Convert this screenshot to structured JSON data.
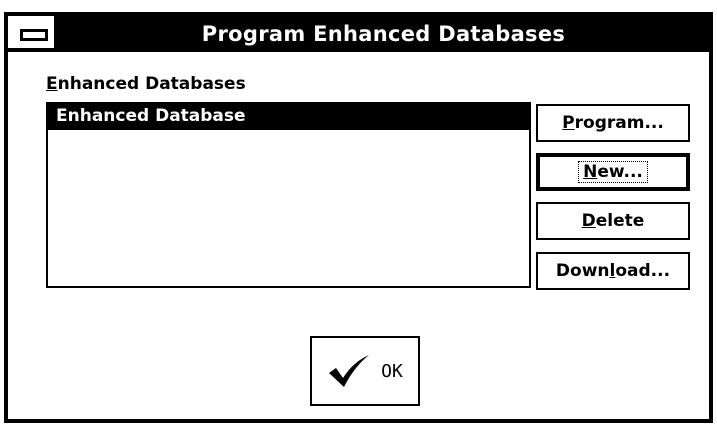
{
  "window": {
    "title": "Program Enhanced Databases"
  },
  "listbox": {
    "label_mnemonic": "E",
    "label_rest": "nhanced Databases",
    "items": [
      "Enhanced Database"
    ],
    "selected_index": 0
  },
  "buttons": {
    "program": {
      "mnemonic": "P",
      "rest": "rogram..."
    },
    "new": {
      "mnemonic": "N",
      "rest": "ew..."
    },
    "delete": {
      "mnemonic": "D",
      "rest": "elete"
    },
    "download": {
      "before": "Down",
      "mnemonic": "l",
      "rest": "oad..."
    },
    "ok": {
      "label": "OK",
      "icon": "checkmark-icon"
    }
  },
  "colors": {
    "foreground": "#000000",
    "background": "#ffffff"
  }
}
